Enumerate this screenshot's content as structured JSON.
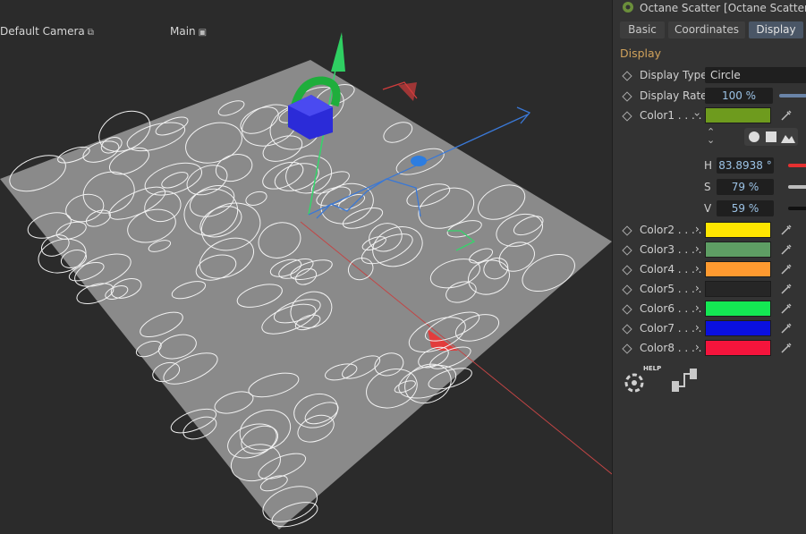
{
  "viewport": {
    "camera_label": "Default Camera",
    "view_label": "Main"
  },
  "panel": {
    "title": "Octane Scatter [Octane Scatter]",
    "tabs": [
      {
        "label": "Basic",
        "active": false
      },
      {
        "label": "Coordinates",
        "active": false
      },
      {
        "label": "Display",
        "active": true
      }
    ],
    "section_title": "Display",
    "display_type": {
      "label": "Display Type",
      "value": "Circle"
    },
    "display_rate": {
      "label": "Display Rate",
      "value": "100 %"
    },
    "color1": {
      "label": "Color1 . . . .",
      "color": "#6e9b1e"
    },
    "hsv": [
      {
        "letter": "H",
        "value": "83.8938 °",
        "slider_color": "#e53030"
      },
      {
        "letter": "S",
        "value": "79 %",
        "slider_color": "#bdbdbd"
      },
      {
        "letter": "V",
        "value": "59 %",
        "slider_color": "#111111"
      }
    ],
    "colors": [
      {
        "label": "Color2 . . . .",
        "color": "#ffe600"
      },
      {
        "label": "Color3 . . . .",
        "color": "#5e9e64"
      },
      {
        "label": "Color4 . . . .",
        "color": "#ff9a30"
      },
      {
        "label": "Color5 . . . .",
        "color": "#262626"
      },
      {
        "label": "Color6 . . . .",
        "color": "#14e853"
      },
      {
        "label": "Color7 . . . .",
        "color": "#0a10e0"
      },
      {
        "label": "Color8 . . . .",
        "color": "#f5143c"
      }
    ],
    "help_label": "HELP"
  }
}
